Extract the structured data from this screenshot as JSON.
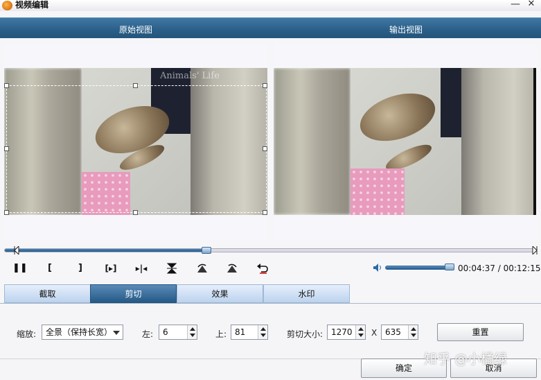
{
  "window": {
    "title": "视频编辑",
    "minimize": "—",
    "close": "✕"
  },
  "views": {
    "original_label": "原始视图",
    "output_label": "输出视图"
  },
  "video": {
    "watermark": "Animals' Life"
  },
  "playback": {
    "progress_fraction": 0.38,
    "volume_fraction": 0.92,
    "time": "00:04:37 / 00:12:15",
    "controls": [
      "pause",
      "mark-in",
      "mark-out",
      "play-selection",
      "next-frame",
      "flip-vertical",
      "flip-left",
      "flip-right",
      "rotate"
    ]
  },
  "tabs": [
    {
      "label": "截取",
      "active": false
    },
    {
      "label": "剪切",
      "active": true
    },
    {
      "label": "效果",
      "active": false
    },
    {
      "label": "水印",
      "active": false
    }
  ],
  "crop": {
    "zoom_label": "缩放:",
    "zoom_value": "全景（保持长宽）",
    "left_label": "左:",
    "left_value": "6",
    "top_label": "上:",
    "top_value": "81",
    "size_label": "剪切大小:",
    "width_value": "1270",
    "times": "X",
    "height_value": "635",
    "reset_button": "重置"
  },
  "footer": {
    "ok_button": "确定",
    "cancel_button": "取消",
    "site_watermark": "知乎 @小橘绿"
  },
  "colors": {
    "header_blue": "#2b5f88",
    "tab_active": "#255a86",
    "progress": "#1f5a8e"
  }
}
